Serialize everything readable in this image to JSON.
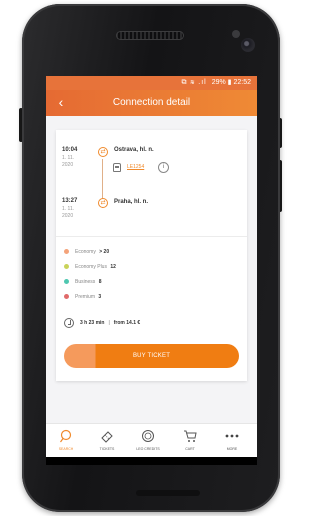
{
  "status_bar": {
    "icons": "⧉ ≋ .ıl",
    "battery": "29%",
    "time": "22:52"
  },
  "app_bar": {
    "back_icon": "chevron-left",
    "title": "Connection detail"
  },
  "connection": {
    "departure": {
      "time": "10:04",
      "date_line1": "1. 11.",
      "date_line2": "2020",
      "station": "Ostrava, hl. n."
    },
    "train": {
      "number": "LE1254"
    },
    "arrival": {
      "time": "13:27",
      "date_line1": "1. 11.",
      "date_line2": "2020",
      "station": "Praha, hl. n."
    }
  },
  "classes": [
    {
      "name": "Economy",
      "count": "> 20",
      "color": "#f4a37a"
    },
    {
      "name": "Economy Plus",
      "count": "12",
      "color": "#c9d35a"
    },
    {
      "name": "Business",
      "count": "8",
      "color": "#4ec7b0"
    },
    {
      "name": "Premium",
      "count": "3",
      "color": "#e06a6a"
    }
  ],
  "summary": {
    "duration": "3 h 23 min",
    "separator": "|",
    "price": "from 14.1 €"
  },
  "buy_button": {
    "label": "BUY TICKET"
  },
  "nav": [
    {
      "label": "SEARCH",
      "icon": "search-icon",
      "active": true
    },
    {
      "label": "TICKETS",
      "icon": "ticket-icon",
      "active": false
    },
    {
      "label": "LEO CREDITS",
      "icon": "credits-icon",
      "active": false
    },
    {
      "label": "CART",
      "icon": "cart-icon",
      "active": false
    },
    {
      "label": "MORE",
      "icon": "more-icon",
      "active": false
    }
  ],
  "colors": {
    "accent": "#f08a2c",
    "app_bar_start": "#e56a33",
    "app_bar_end": "#ef8a35"
  }
}
